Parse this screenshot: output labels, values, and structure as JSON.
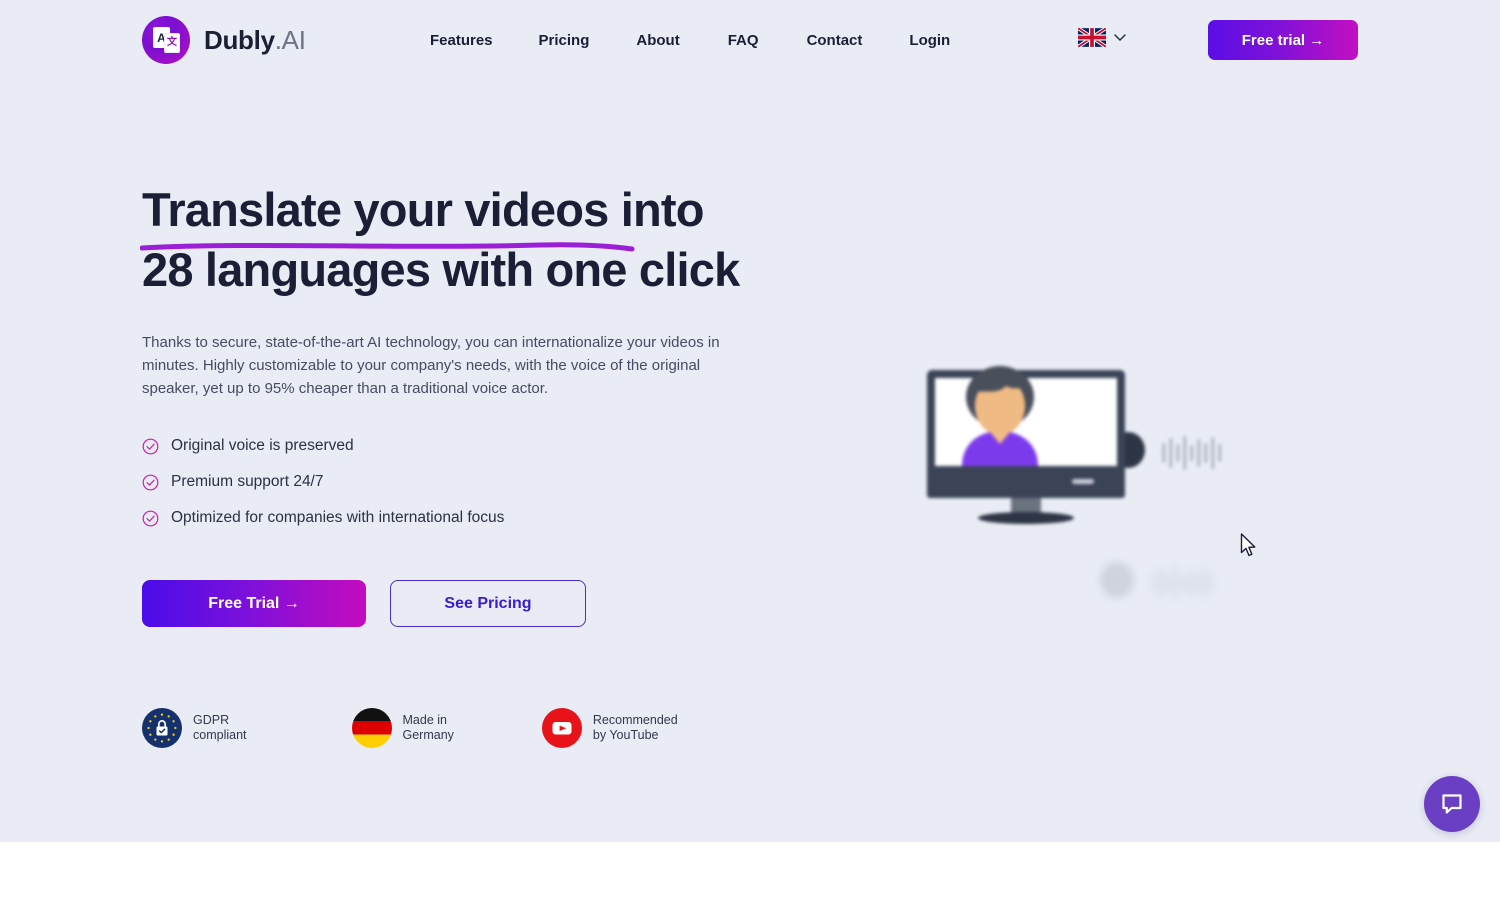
{
  "brand": {
    "name": "Dubly",
    "suffix": ".AI",
    "logo_icon": "translate-cards-icon",
    "logo_letter_back": "A",
    "logo_letter_front": "文"
  },
  "nav": {
    "items": [
      {
        "label": "Features"
      },
      {
        "label": "Pricing"
      },
      {
        "label": "About"
      },
      {
        "label": "FAQ"
      },
      {
        "label": "Contact"
      },
      {
        "label": "Login"
      }
    ],
    "language": {
      "flag_icon": "uk-flag-icon",
      "chevron_icon": "chevron-down-icon"
    },
    "free_trial_label": "Free trial →"
  },
  "hero": {
    "headline_highlight": "Translate your videos",
    "headline_rest": " into",
    "headline_line2": "28 languages with one click",
    "underline_color": "#9b1fd6",
    "subtitle": "Thanks to secure, state-of-the-art AI technology, you can internationalize your videos in minutes. Highly customizable to your company's needs, with the voice of the original speaker, yet up to 95% cheaper than a traditional voice actor.",
    "features": [
      {
        "icon": "check-circle-icon",
        "label": "Original voice is preserved"
      },
      {
        "icon": "check-circle-icon",
        "label": "Premium support 24/7"
      },
      {
        "icon": "check-circle-icon",
        "label": "Optimized for companies with international focus"
      }
    ],
    "feature_icon_color": "#c81fb0",
    "cta_primary": "Free Trial →",
    "cta_secondary": "See Pricing",
    "badges": [
      {
        "icon": "gdpr-shield-icon",
        "label": "GDPR\ncompliant"
      },
      {
        "icon": "german-flag-icon",
        "label": "Made in\nGermany"
      },
      {
        "icon": "youtube-icon",
        "label": "Recommended\nby YouTube"
      }
    ],
    "illustration": {
      "name": "video-dubbing-illustration",
      "monitor_icon": "monitor-icon",
      "person_icon": "person-avatar-icon",
      "speaker_icon": "speaker-icon",
      "waveform_icon": "audio-waveform-icon"
    }
  },
  "chat": {
    "icon": "chat-bubble-icon",
    "color": "#6b3fc4"
  },
  "cursor": {
    "icon": "mouse-pointer-icon"
  },
  "colors": {
    "hero_background": "#e9ecf5",
    "page_background": "#ffffff",
    "text_dark": "#1b1f36",
    "accent_gradient_start": "#4a0ce8",
    "accent_gradient_end": "#c40cbe",
    "outline_button": "#3a1cc9"
  }
}
